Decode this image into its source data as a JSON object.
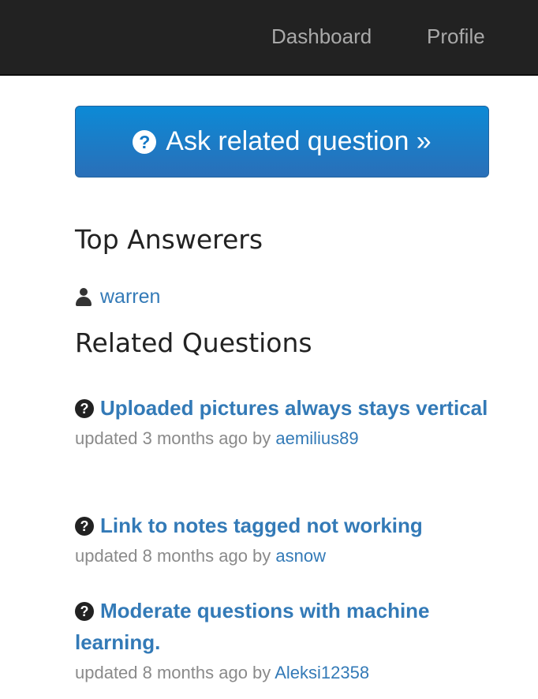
{
  "nav": {
    "dashboard": "Dashboard",
    "profile": "Profile"
  },
  "ask_button": {
    "label": "Ask related question »",
    "icon": "question-circle-icon"
  },
  "top_answerers": {
    "title": "Top Answerers",
    "users": [
      {
        "name": "warren",
        "icon": "user-icon"
      }
    ]
  },
  "related_questions": {
    "title": "Related Questions",
    "items": [
      {
        "title": "Uploaded pictures always stays vertical",
        "updated": "updated 3 months ago by",
        "author": "aemilius89"
      },
      {
        "title": "Link to notes tagged not working",
        "updated": "updated 8 months ago by",
        "author": "asnow"
      },
      {
        "title": "Moderate questions with machine learning.",
        "updated": "updated 8 months ago by",
        "author": "Aleksi12358"
      }
    ]
  },
  "colors": {
    "navbar_bg": "#222222",
    "nav_text": "#a9a9a9",
    "primary": "#1479c6",
    "link": "#337ab7",
    "meta_text": "#8a8a8a"
  }
}
